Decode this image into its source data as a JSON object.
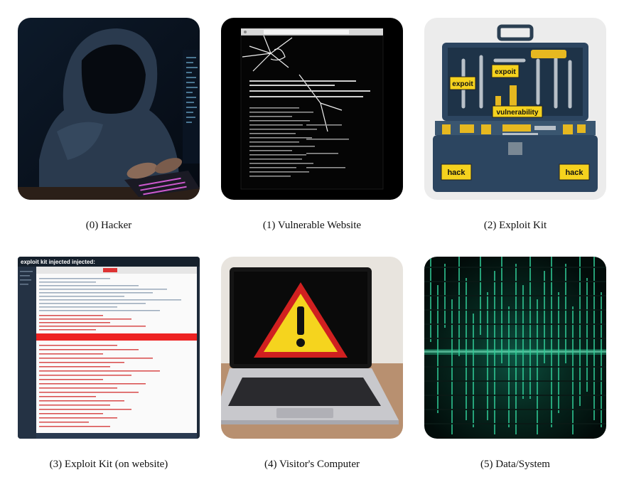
{
  "panels": [
    {
      "label": "(0) Hacker"
    },
    {
      "label": "(1) Vulnerable Website"
    },
    {
      "label": "(2) Exploit Kit",
      "tags": [
        "expoit",
        "expoit",
        "vulnerability",
        "hack",
        "hack"
      ]
    },
    {
      "label": "(3) Exploit Kit (on website)",
      "header": "exploit kit injected injected:"
    },
    {
      "label": "(4) Visitor's Computer"
    },
    {
      "label": "(5) Data/System"
    }
  ]
}
